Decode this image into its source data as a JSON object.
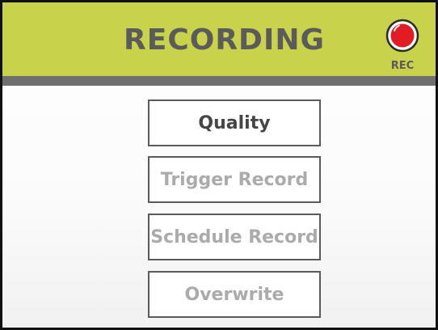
{
  "header": {
    "title": "RECORDING",
    "rec_label": "REC",
    "rec_icon": "record-icon"
  },
  "menu": [
    {
      "label": "Quality",
      "enabled": true
    },
    {
      "label": "Trigger Record",
      "enabled": false
    },
    {
      "label": "Schedule Record",
      "enabled": false
    },
    {
      "label": "Overwrite",
      "enabled": false
    }
  ],
  "colors": {
    "header_bg": "#c8d24a",
    "header_bar": "#6f6f6f",
    "title_text": "#5b5b5b",
    "rec_red": "#e31b23",
    "button_border": "#5a5a5a",
    "active_text": "#454545",
    "disabled_text": "#ababab"
  }
}
